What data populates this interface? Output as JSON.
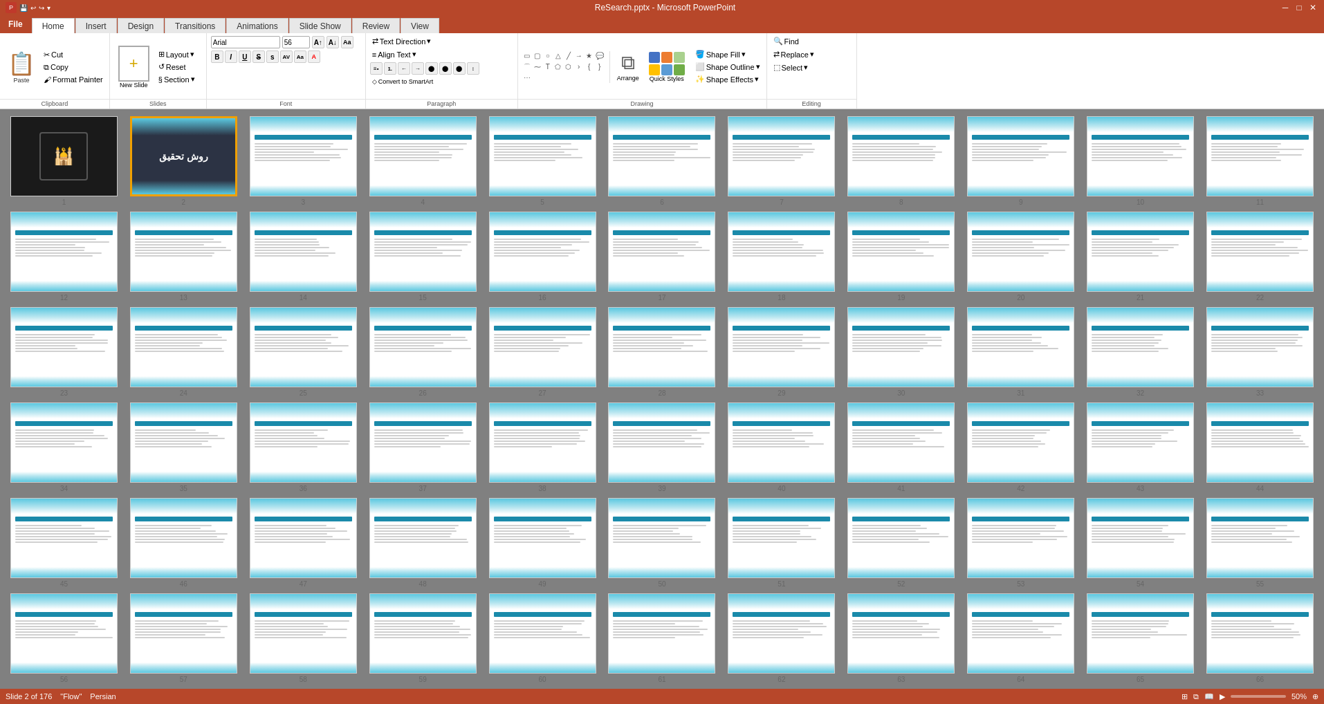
{
  "titleBar": {
    "appName": "ReSearch.pptx - Microsoft PowerPoint",
    "minBtn": "─",
    "maxBtn": "□",
    "closeBtn": "✕"
  },
  "quickAccess": {
    "icons": [
      "💾",
      "↩",
      "↪"
    ]
  },
  "ribbon": {
    "tabs": [
      "File",
      "Home",
      "Insert",
      "Design",
      "Transitions",
      "Animations",
      "Slide Show",
      "Review",
      "View"
    ],
    "activeTab": "Home",
    "groups": {
      "clipboard": {
        "label": "Clipboard",
        "paste": "Paste",
        "cut": "Cut",
        "copy": "Copy",
        "formatPainter": "Format Painter"
      },
      "slides": {
        "label": "Slides",
        "newSlide": "New Slide",
        "layout": "Layout",
        "reset": "Reset",
        "section": "Section"
      },
      "font": {
        "label": "Font",
        "fontName": "Arial",
        "fontSize": "56",
        "bold": "B",
        "italic": "I",
        "underline": "U",
        "strikethrough": "S",
        "shadow": "S"
      },
      "paragraph": {
        "label": "Paragraph",
        "textDirection": "Text Direction",
        "alignText": "Align Text",
        "convertToSmartArt": "Convert to SmartArt"
      },
      "drawing": {
        "label": "Drawing",
        "shapeFill": "Shape Fill",
        "shapeOutline": "Shape Outline",
        "shapeEffects": "Shape Effects",
        "arrange": "Arrange",
        "quickStyles": "Quick Styles"
      },
      "editing": {
        "label": "Editing",
        "find": "Find",
        "replace": "Replace",
        "select": "Select"
      }
    }
  },
  "statusBar": {
    "slideInfo": "Slide 2 of 176",
    "theme": "\"Flow\"",
    "language": "Persian",
    "zoom": "50%"
  },
  "slides": [
    {
      "num": 1,
      "type": "dark-logo"
    },
    {
      "num": 2,
      "type": "dark-title",
      "selected": true,
      "titleText": "روش تحقیق"
    },
    {
      "num": 3,
      "type": "wave-content"
    },
    {
      "num": 4,
      "type": "wave-content"
    },
    {
      "num": 5,
      "type": "wave-content"
    },
    {
      "num": 6,
      "type": "wave-content"
    },
    {
      "num": 7,
      "type": "wave-content"
    },
    {
      "num": 8,
      "type": "wave-content"
    },
    {
      "num": 9,
      "type": "wave-content"
    },
    {
      "num": 10,
      "type": "wave-content"
    },
    {
      "num": 11,
      "type": "wave-content"
    },
    {
      "num": 12,
      "type": "wave-content"
    },
    {
      "num": 13,
      "type": "wave-content"
    },
    {
      "num": 14,
      "type": "wave-content"
    },
    {
      "num": 15,
      "type": "wave-content"
    },
    {
      "num": 16,
      "type": "wave-content"
    },
    {
      "num": 17,
      "type": "wave-content"
    },
    {
      "num": 18,
      "type": "wave-content"
    },
    {
      "num": 19,
      "type": "wave-content"
    },
    {
      "num": 20,
      "type": "wave-content"
    },
    {
      "num": 21,
      "type": "wave-content"
    },
    {
      "num": 22,
      "type": "wave-content"
    },
    {
      "num": 23,
      "type": "wave-content"
    },
    {
      "num": 24,
      "type": "wave-content"
    },
    {
      "num": 25,
      "type": "wave-content"
    },
    {
      "num": 26,
      "type": "wave-content"
    },
    {
      "num": 27,
      "type": "wave-content"
    },
    {
      "num": 28,
      "type": "wave-content"
    },
    {
      "num": 29,
      "type": "wave-content"
    },
    {
      "num": 30,
      "type": "wave-content"
    },
    {
      "num": 31,
      "type": "wave-content"
    },
    {
      "num": 32,
      "type": "wave-content"
    },
    {
      "num": 33,
      "type": "wave-content"
    },
    {
      "num": 34,
      "type": "wave-content"
    },
    {
      "num": 35,
      "type": "wave-content"
    },
    {
      "num": 36,
      "type": "wave-content"
    },
    {
      "num": 37,
      "type": "wave-content"
    },
    {
      "num": 38,
      "type": "wave-content"
    },
    {
      "num": 39,
      "type": "wave-content"
    },
    {
      "num": 40,
      "type": "wave-content"
    },
    {
      "num": 41,
      "type": "wave-content"
    },
    {
      "num": 42,
      "type": "wave-content"
    },
    {
      "num": 43,
      "type": "wave-content"
    },
    {
      "num": 44,
      "type": "wave-content"
    },
    {
      "num": 45,
      "type": "wave-content"
    },
    {
      "num": 46,
      "type": "wave-content"
    },
    {
      "num": 47,
      "type": "wave-content"
    },
    {
      "num": 48,
      "type": "wave-content"
    },
    {
      "num": 49,
      "type": "wave-content"
    },
    {
      "num": 50,
      "type": "wave-content"
    },
    {
      "num": 51,
      "type": "wave-content"
    },
    {
      "num": 52,
      "type": "wave-content"
    },
    {
      "num": 53,
      "type": "wave-content"
    },
    {
      "num": 54,
      "type": "wave-content"
    },
    {
      "num": 55,
      "type": "wave-content"
    },
    {
      "num": 56,
      "type": "wave-content"
    },
    {
      "num": 57,
      "type": "wave-content"
    },
    {
      "num": 58,
      "type": "wave-content"
    },
    {
      "num": 59,
      "type": "wave-content"
    },
    {
      "num": 60,
      "type": "wave-content"
    },
    {
      "num": 61,
      "type": "wave-content"
    },
    {
      "num": 62,
      "type": "wave-content"
    },
    {
      "num": 63,
      "type": "wave-content"
    },
    {
      "num": 64,
      "type": "wave-content"
    },
    {
      "num": 65,
      "type": "wave-content"
    },
    {
      "num": 66,
      "type": "wave-content"
    }
  ]
}
